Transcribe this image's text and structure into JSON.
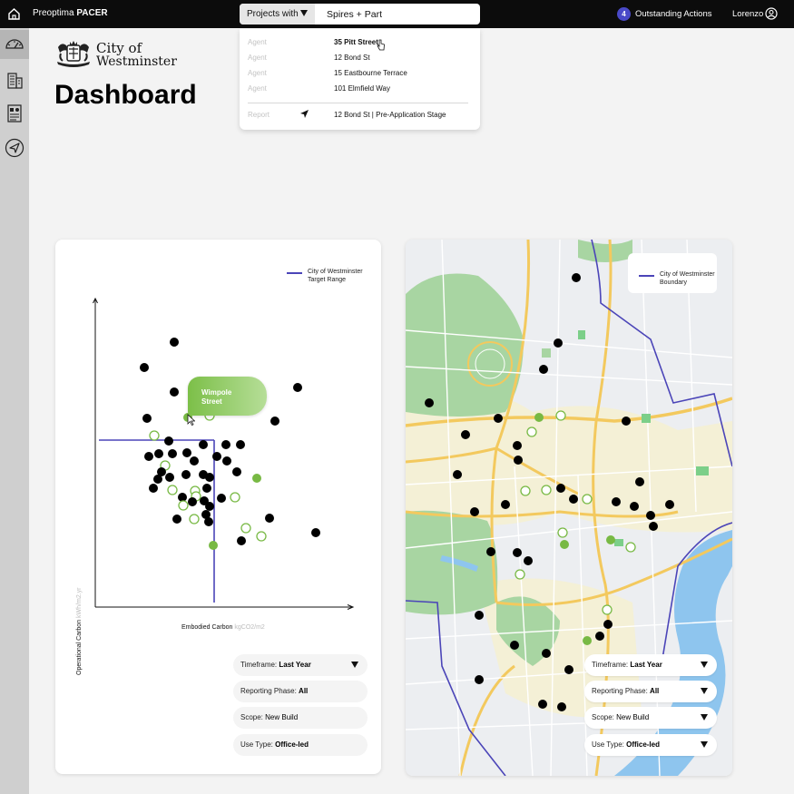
{
  "app": {
    "name_prefix": "Preoptima ",
    "name_bold": "PACER"
  },
  "search": {
    "select_label": "Projects with",
    "value": "Spires + Part"
  },
  "header": {
    "actions_count": "4",
    "actions_label": "Outstanding Actions",
    "user_name": "Lorenzo"
  },
  "logo": {
    "line1": "City of",
    "line2": "Westminster"
  },
  "page": {
    "title": "Dashboard"
  },
  "dropdown": {
    "items": [
      {
        "type": "Agent",
        "text": "35 Pitt Street"
      },
      {
        "type": "Agent",
        "text": "12 Bond St"
      },
      {
        "type": "Agent",
        "text": "15 Eastbourne Terrace"
      },
      {
        "type": "Agent",
        "text": "101 Elmfield Way"
      }
    ],
    "report": {
      "type": "Report",
      "text": "12 Bond St | Pre-Application Stage"
    }
  },
  "sidebar": {
    "items": [
      {
        "icon": "gauge-icon",
        "active": true
      },
      {
        "icon": "building-icon",
        "active": false
      },
      {
        "icon": "report-icon",
        "active": false
      },
      {
        "icon": "send-icon",
        "active": false
      }
    ]
  },
  "chart": {
    "legend": "City of Westminster\nTarget Range",
    "ylabel": "Operational Carbon ",
    "ylabel_unit": "kWh/m2.yr",
    "xlabel": "Embodied Carbon ",
    "xlabel_unit": "kgCO2/m2",
    "tooltip": "Wimpole\nStreet",
    "filters": [
      {
        "label": "Timeframe: ",
        "value": "Last Year",
        "caret": true
      },
      {
        "label": "Reporting Phase: ",
        "value": "All",
        "caret": false
      },
      {
        "label": "Scope: ",
        "value": "New Build",
        "caret": false
      },
      {
        "label": "Use Type: ",
        "value": "Office-led",
        "caret": false
      }
    ]
  },
  "map": {
    "legend": "City of Westminster\nBoundary",
    "filters": [
      {
        "label": "Timeframe: ",
        "value": "Last Year",
        "caret": true
      },
      {
        "label": "Reporting Phase: ",
        "value": "All",
        "caret": true
      },
      {
        "label": "Scope: ",
        "value": "New Build",
        "caret": true
      },
      {
        "label": "Use Type: ",
        "value": "Office-led",
        "caret": true
      }
    ]
  },
  "colors": {
    "accent": "#4b45b8",
    "green": "#78b944",
    "black": "#000000",
    "topbar": "#0c0c0c"
  }
}
